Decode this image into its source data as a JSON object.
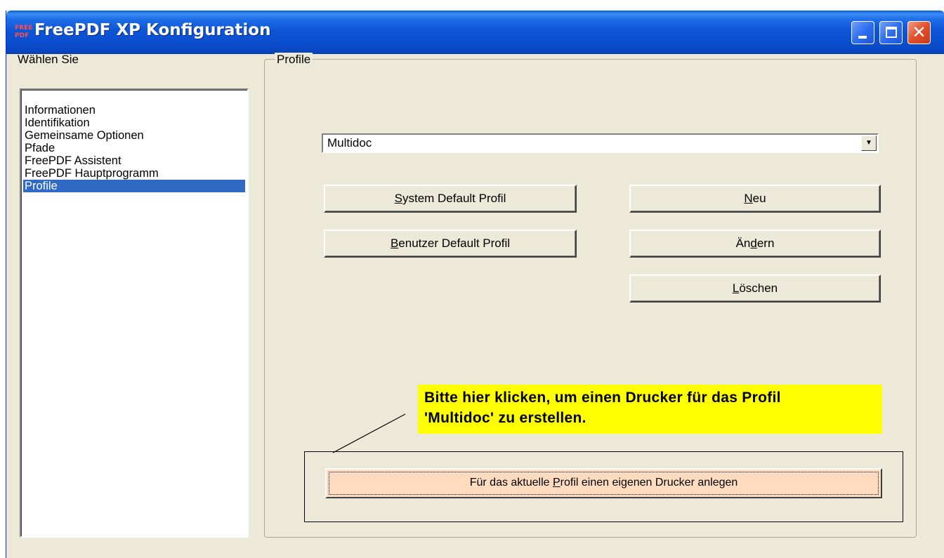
{
  "window": {
    "title": "FreePDF XP Konfiguration",
    "icon_text_top": "FREE",
    "icon_text_bottom": "PDF"
  },
  "titlebar_buttons": {
    "close_glyph": "✕"
  },
  "left_panel": {
    "label": "Wählen Sie",
    "items": [
      {
        "label": "Informationen",
        "selected": false
      },
      {
        "label": "Identifikation",
        "selected": false
      },
      {
        "label": "Gemeinsame Optionen",
        "selected": false
      },
      {
        "label": "Pfade",
        "selected": false
      },
      {
        "label": "FreePDF Assistent",
        "selected": false
      },
      {
        "label": "FreePDF Hauptprogramm",
        "selected": false
      },
      {
        "label": "Profile",
        "selected": true
      }
    ]
  },
  "profile_group": {
    "legend": "Profile",
    "combo_value": "Multidoc",
    "combo_arrow": "▼"
  },
  "buttons": {
    "system_default": {
      "prefix": "",
      "accel": "S",
      "suffix": "ystem Default Profil"
    },
    "user_default": {
      "prefix": "",
      "accel": "B",
      "suffix": "enutzer Default Profil"
    },
    "neu": {
      "prefix": "",
      "accel": "N",
      "suffix": "eu"
    },
    "aendern": {
      "prefix": "Än",
      "accel": "d",
      "suffix": "ern"
    },
    "loeschen": {
      "prefix": "",
      "accel": "L",
      "suffix": "öschen"
    },
    "printer": {
      "prefix": "Für das aktuelle ",
      "accel": "P",
      "suffix": "rofil einen eigenen Drucker anlegen"
    }
  },
  "callout": {
    "line1": "Bitte hier klicken, um einen Drucker für das Profil",
    "line2": "'Multidoc' zu erstellen.",
    "background": "#ffff00"
  },
  "colors": {
    "selection": "#316ac5",
    "dialog_bg": "#ece9d8",
    "printer_button_bg": "#ffdcc0"
  }
}
